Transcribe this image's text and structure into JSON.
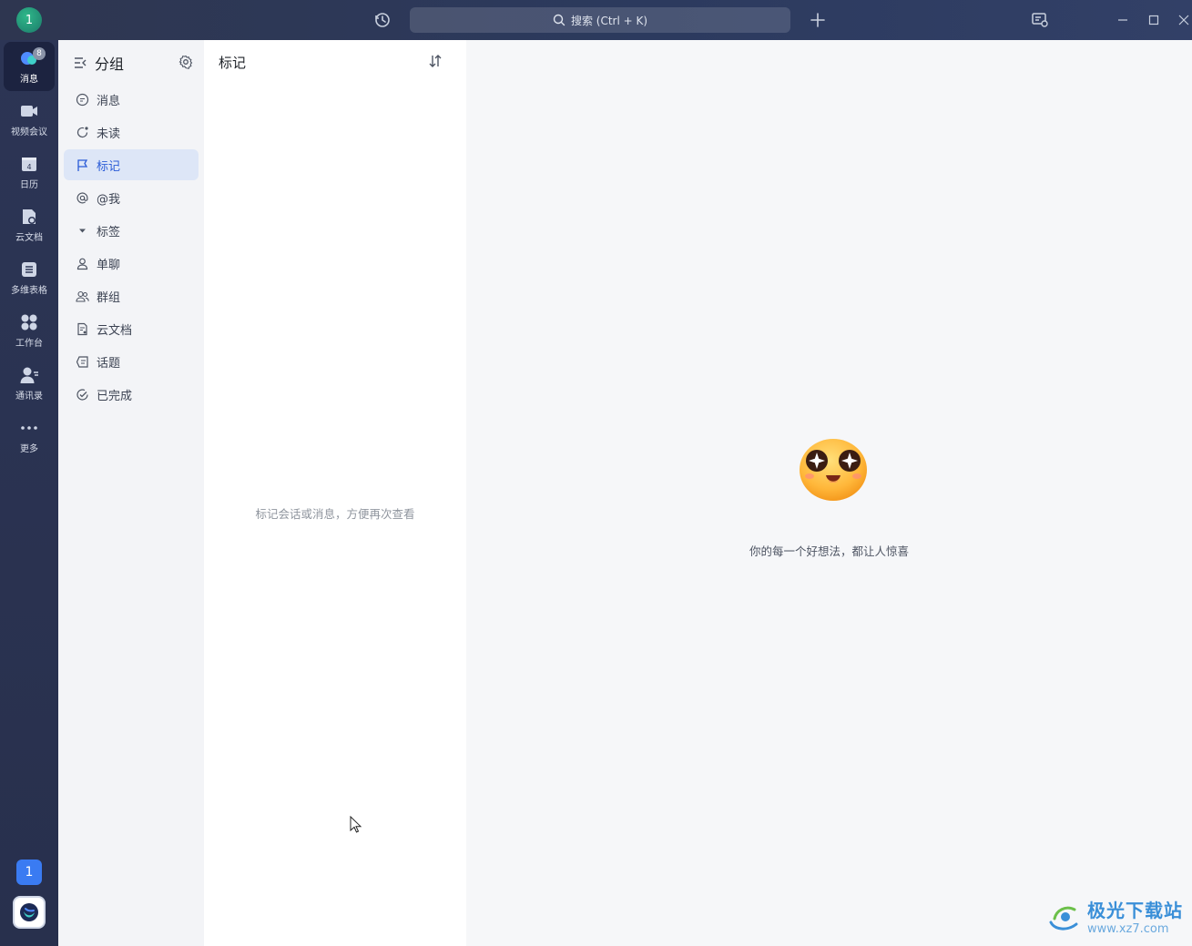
{
  "titlebar": {
    "avatar_text": "1",
    "search_placeholder": "搜索 (Ctrl + K)",
    "icons": [
      "history-icon",
      "add-icon",
      "screen-share-icon",
      "minimize-icon",
      "maximize-icon",
      "close-icon"
    ]
  },
  "rail": {
    "items": [
      {
        "label": "消息",
        "icon": "message-icon",
        "badge": "8",
        "active": true
      },
      {
        "label": "视频会议",
        "icon": "video-icon"
      },
      {
        "label": "日历",
        "icon": "calendar-icon",
        "day": "4"
      },
      {
        "label": "云文档",
        "icon": "cloud-doc-icon"
      },
      {
        "label": "多维表格",
        "icon": "table-icon"
      },
      {
        "label": "工作台",
        "icon": "workbench-icon"
      },
      {
        "label": "通讯录",
        "icon": "contacts-icon"
      },
      {
        "label": "更多",
        "icon": "more-icon"
      }
    ],
    "bottom_badge": "1"
  },
  "groups": {
    "title": "分组",
    "items": [
      {
        "label": "消息",
        "icon": "chat-bubble-icon"
      },
      {
        "label": "未读",
        "icon": "unread-icon"
      },
      {
        "label": "标记",
        "icon": "flag-icon",
        "active": true
      },
      {
        "label": "@我",
        "icon": "at-icon"
      },
      {
        "label": "标签",
        "icon": "caret-down-icon"
      },
      {
        "label": "单聊",
        "icon": "person-icon"
      },
      {
        "label": "群组",
        "icon": "group-icon"
      },
      {
        "label": "云文档",
        "icon": "doc-icon"
      },
      {
        "label": "话题",
        "icon": "topic-icon"
      },
      {
        "label": "已完成",
        "icon": "check-circle-icon"
      }
    ]
  },
  "middle": {
    "title": "标记",
    "empty_text": "标记会话或消息，方便再次查看"
  },
  "detail": {
    "message": "你的每一个好想法，都让人惊喜"
  },
  "watermark": {
    "name": "极光下载站",
    "url": "www.xz7.com"
  },
  "colors": {
    "accent": "#2a5bd7",
    "rail_bg": "#2c3555",
    "active_group_bg": "#dde6f7"
  }
}
